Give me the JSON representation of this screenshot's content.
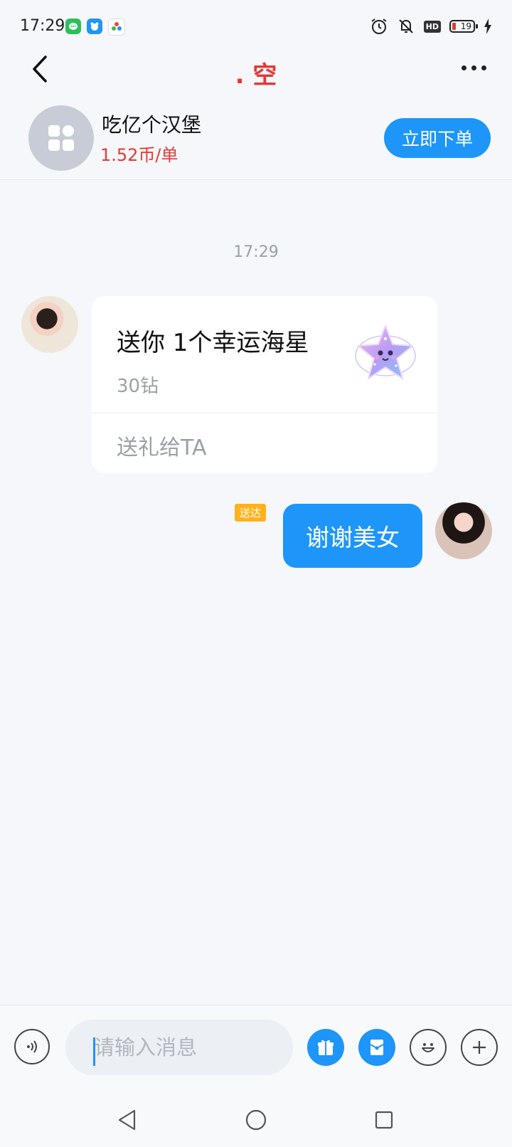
{
  "status_bar": {
    "time": "17:29",
    "battery": "19"
  },
  "header": {
    "title": ". 空"
  },
  "service": {
    "name": "吃亿个汉堡",
    "price": "1.52币/单",
    "order_button": "立即下单"
  },
  "chat": {
    "timestamp": "17:29",
    "gift_message": {
      "title": "送你 1个幸运海星",
      "price": "30钻",
      "send_link": "送礼给TA"
    },
    "sent_message": {
      "text": "谢谢美女",
      "status": "送达"
    }
  },
  "input": {
    "placeholder": "请输入消息"
  },
  "colors": {
    "accent": "#1e95f8",
    "title_red": "#e53935",
    "status_tag": "#ffb21e"
  }
}
